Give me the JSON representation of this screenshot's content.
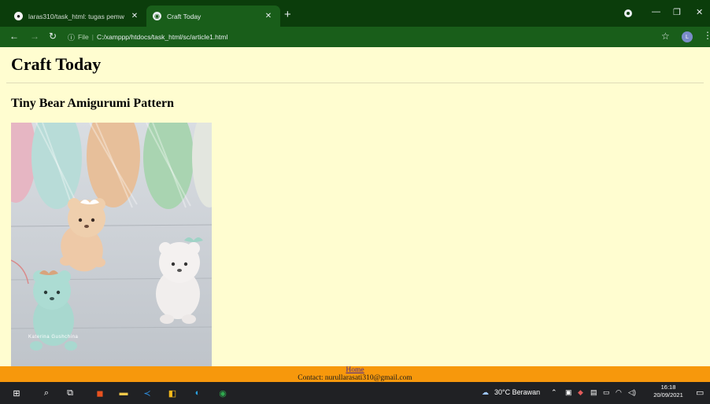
{
  "browser": {
    "tabs": [
      {
        "label": "laras310/task_html: tugas pemw",
        "icon": "github-icon"
      },
      {
        "label": "Craft Today",
        "icon": "globe-icon",
        "active": true
      }
    ],
    "address": {
      "info_label": "File",
      "url": "C:/xamppp/htdocs/task_html/sc/article1.html"
    },
    "profile_initial": "L",
    "accent": "#195e1a"
  },
  "page": {
    "site_title": "Craft Today",
    "article_title": "Tiny Bear Amigurumi Pattern",
    "photo_watermark": "Katerina Gushchina",
    "background": "#fffdd0"
  },
  "footer": {
    "home_link": "Home",
    "contact": "Contact: nurullarasati310@gmail.com",
    "background": "#f7980c"
  },
  "taskbar": {
    "weather": "30°C  Berawan",
    "time": "16:18",
    "date": "20/09/2021"
  }
}
